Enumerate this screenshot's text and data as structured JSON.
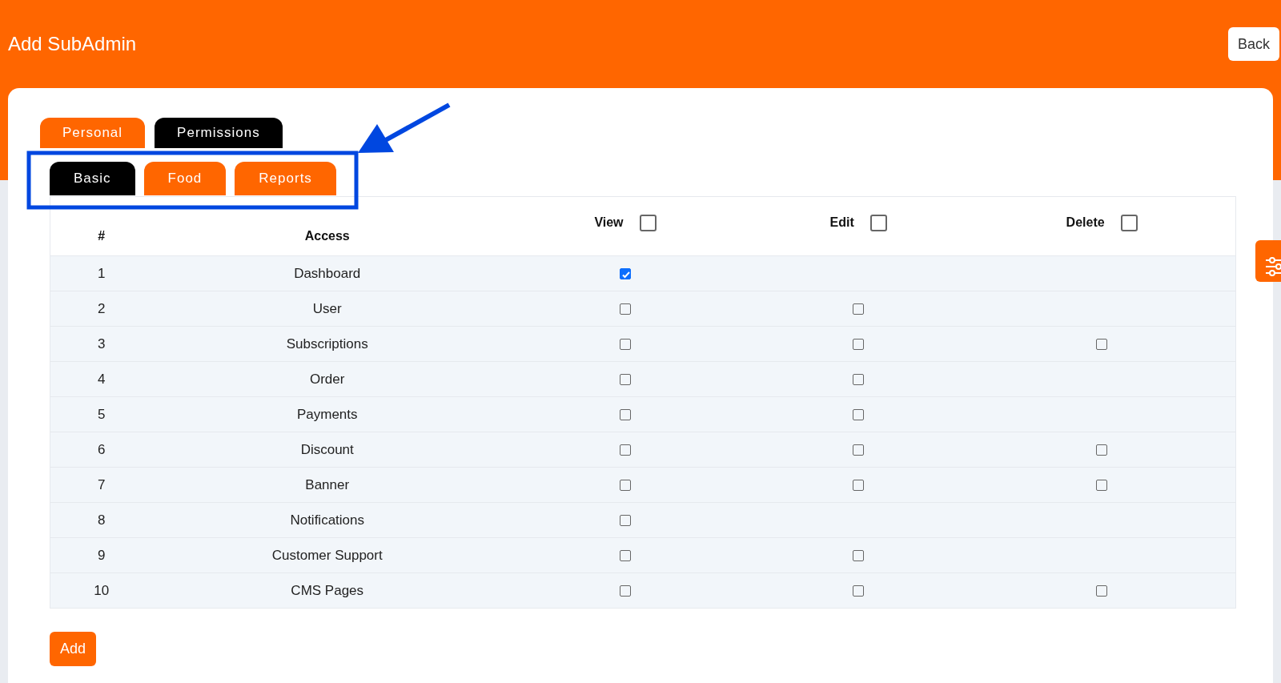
{
  "header": {
    "title": "Add SubAdmin",
    "back_button": "Back"
  },
  "tabs": [
    {
      "label": "Personal",
      "selected": false
    },
    {
      "label": "Permissions",
      "selected": true
    }
  ],
  "subtabs": [
    {
      "label": "Basic",
      "selected": true
    },
    {
      "label": "Food",
      "selected": false
    },
    {
      "label": "Reports",
      "selected": false
    }
  ],
  "table": {
    "columns": [
      {
        "label": "#"
      },
      {
        "label": "Access"
      },
      {
        "label": "View",
        "checked": false
      },
      {
        "label": "Edit",
        "checked": false
      },
      {
        "label": "Delete",
        "checked": false
      }
    ],
    "rows": [
      {
        "number": "1",
        "access": "Dashboard",
        "view": {
          "checked": true
        }
      },
      {
        "number": "2",
        "access": "User",
        "view": {
          "checked": false
        },
        "edit": {
          "checked": false
        }
      },
      {
        "number": "3",
        "access": "Subscriptions",
        "view": {
          "checked": false
        },
        "edit": {
          "checked": false
        },
        "delete": {
          "checked": false
        }
      },
      {
        "number": "4",
        "access": "Order",
        "view": {
          "checked": false
        },
        "edit": {
          "checked": false
        }
      },
      {
        "number": "5",
        "access": "Payments",
        "view": {
          "checked": false
        },
        "edit": {
          "checked": false
        }
      },
      {
        "number": "6",
        "access": "Discount",
        "view": {
          "checked": false
        },
        "edit": {
          "checked": false
        },
        "delete": {
          "checked": false
        }
      },
      {
        "number": "7",
        "access": "Banner",
        "view": {
          "checked": false
        },
        "edit": {
          "checked": false
        },
        "delete": {
          "checked": false
        }
      },
      {
        "number": "8",
        "access": "Notifications",
        "view": {
          "checked": false
        }
      },
      {
        "number": "9",
        "access": "Customer Support",
        "view": {
          "checked": false
        },
        "edit": {
          "checked": false
        }
      },
      {
        "number": "10",
        "access": "CMS Pages",
        "view": {
          "checked": false
        },
        "edit": {
          "checked": false
        },
        "delete": {
          "checked": false
        }
      }
    ]
  },
  "add_button": "Add"
}
